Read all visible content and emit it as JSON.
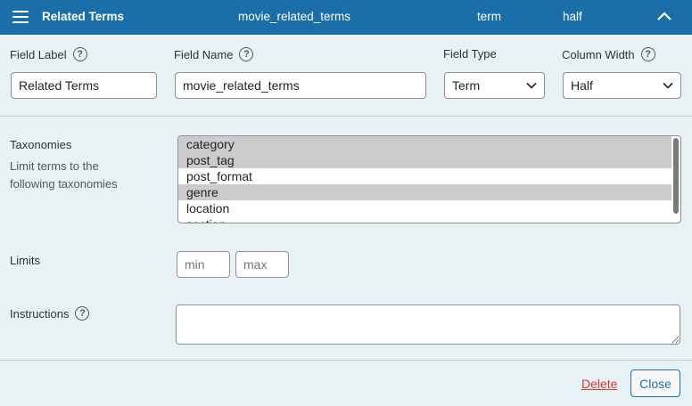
{
  "header": {
    "title": "Related Terms",
    "name": "movie_related_terms",
    "type": "term",
    "width": "half"
  },
  "fields": {
    "label": {
      "label": "Field Label",
      "value": "Related Terms"
    },
    "name": {
      "label": "Field Name",
      "value": "movie_related_terms"
    },
    "type": {
      "label": "Field Type",
      "value": "Term"
    },
    "width": {
      "label": "Column Width",
      "value": "Half"
    }
  },
  "help_glyph": "?",
  "taxonomies": {
    "label": "Taxonomies",
    "description": "Limit terms to the following taxonomies",
    "options": [
      {
        "label": "category",
        "selected": true
      },
      {
        "label": "post_tag",
        "selected": true
      },
      {
        "label": "post_format",
        "selected": false
      },
      {
        "label": "genre",
        "selected": true
      },
      {
        "label": "location",
        "selected": false
      },
      {
        "label": "section",
        "selected": false
      }
    ]
  },
  "limits": {
    "label": "Limits",
    "min_placeholder": "min",
    "max_placeholder": "max"
  },
  "instructions": {
    "label": "Instructions",
    "value": ""
  },
  "footer": {
    "delete_label": "Delete",
    "close_label": "Close"
  },
  "colors": {
    "header_bg": "#1b6fa8",
    "panel_bg": "#e8f1f4",
    "delete": "#d63638",
    "accent": "#2271b1"
  }
}
